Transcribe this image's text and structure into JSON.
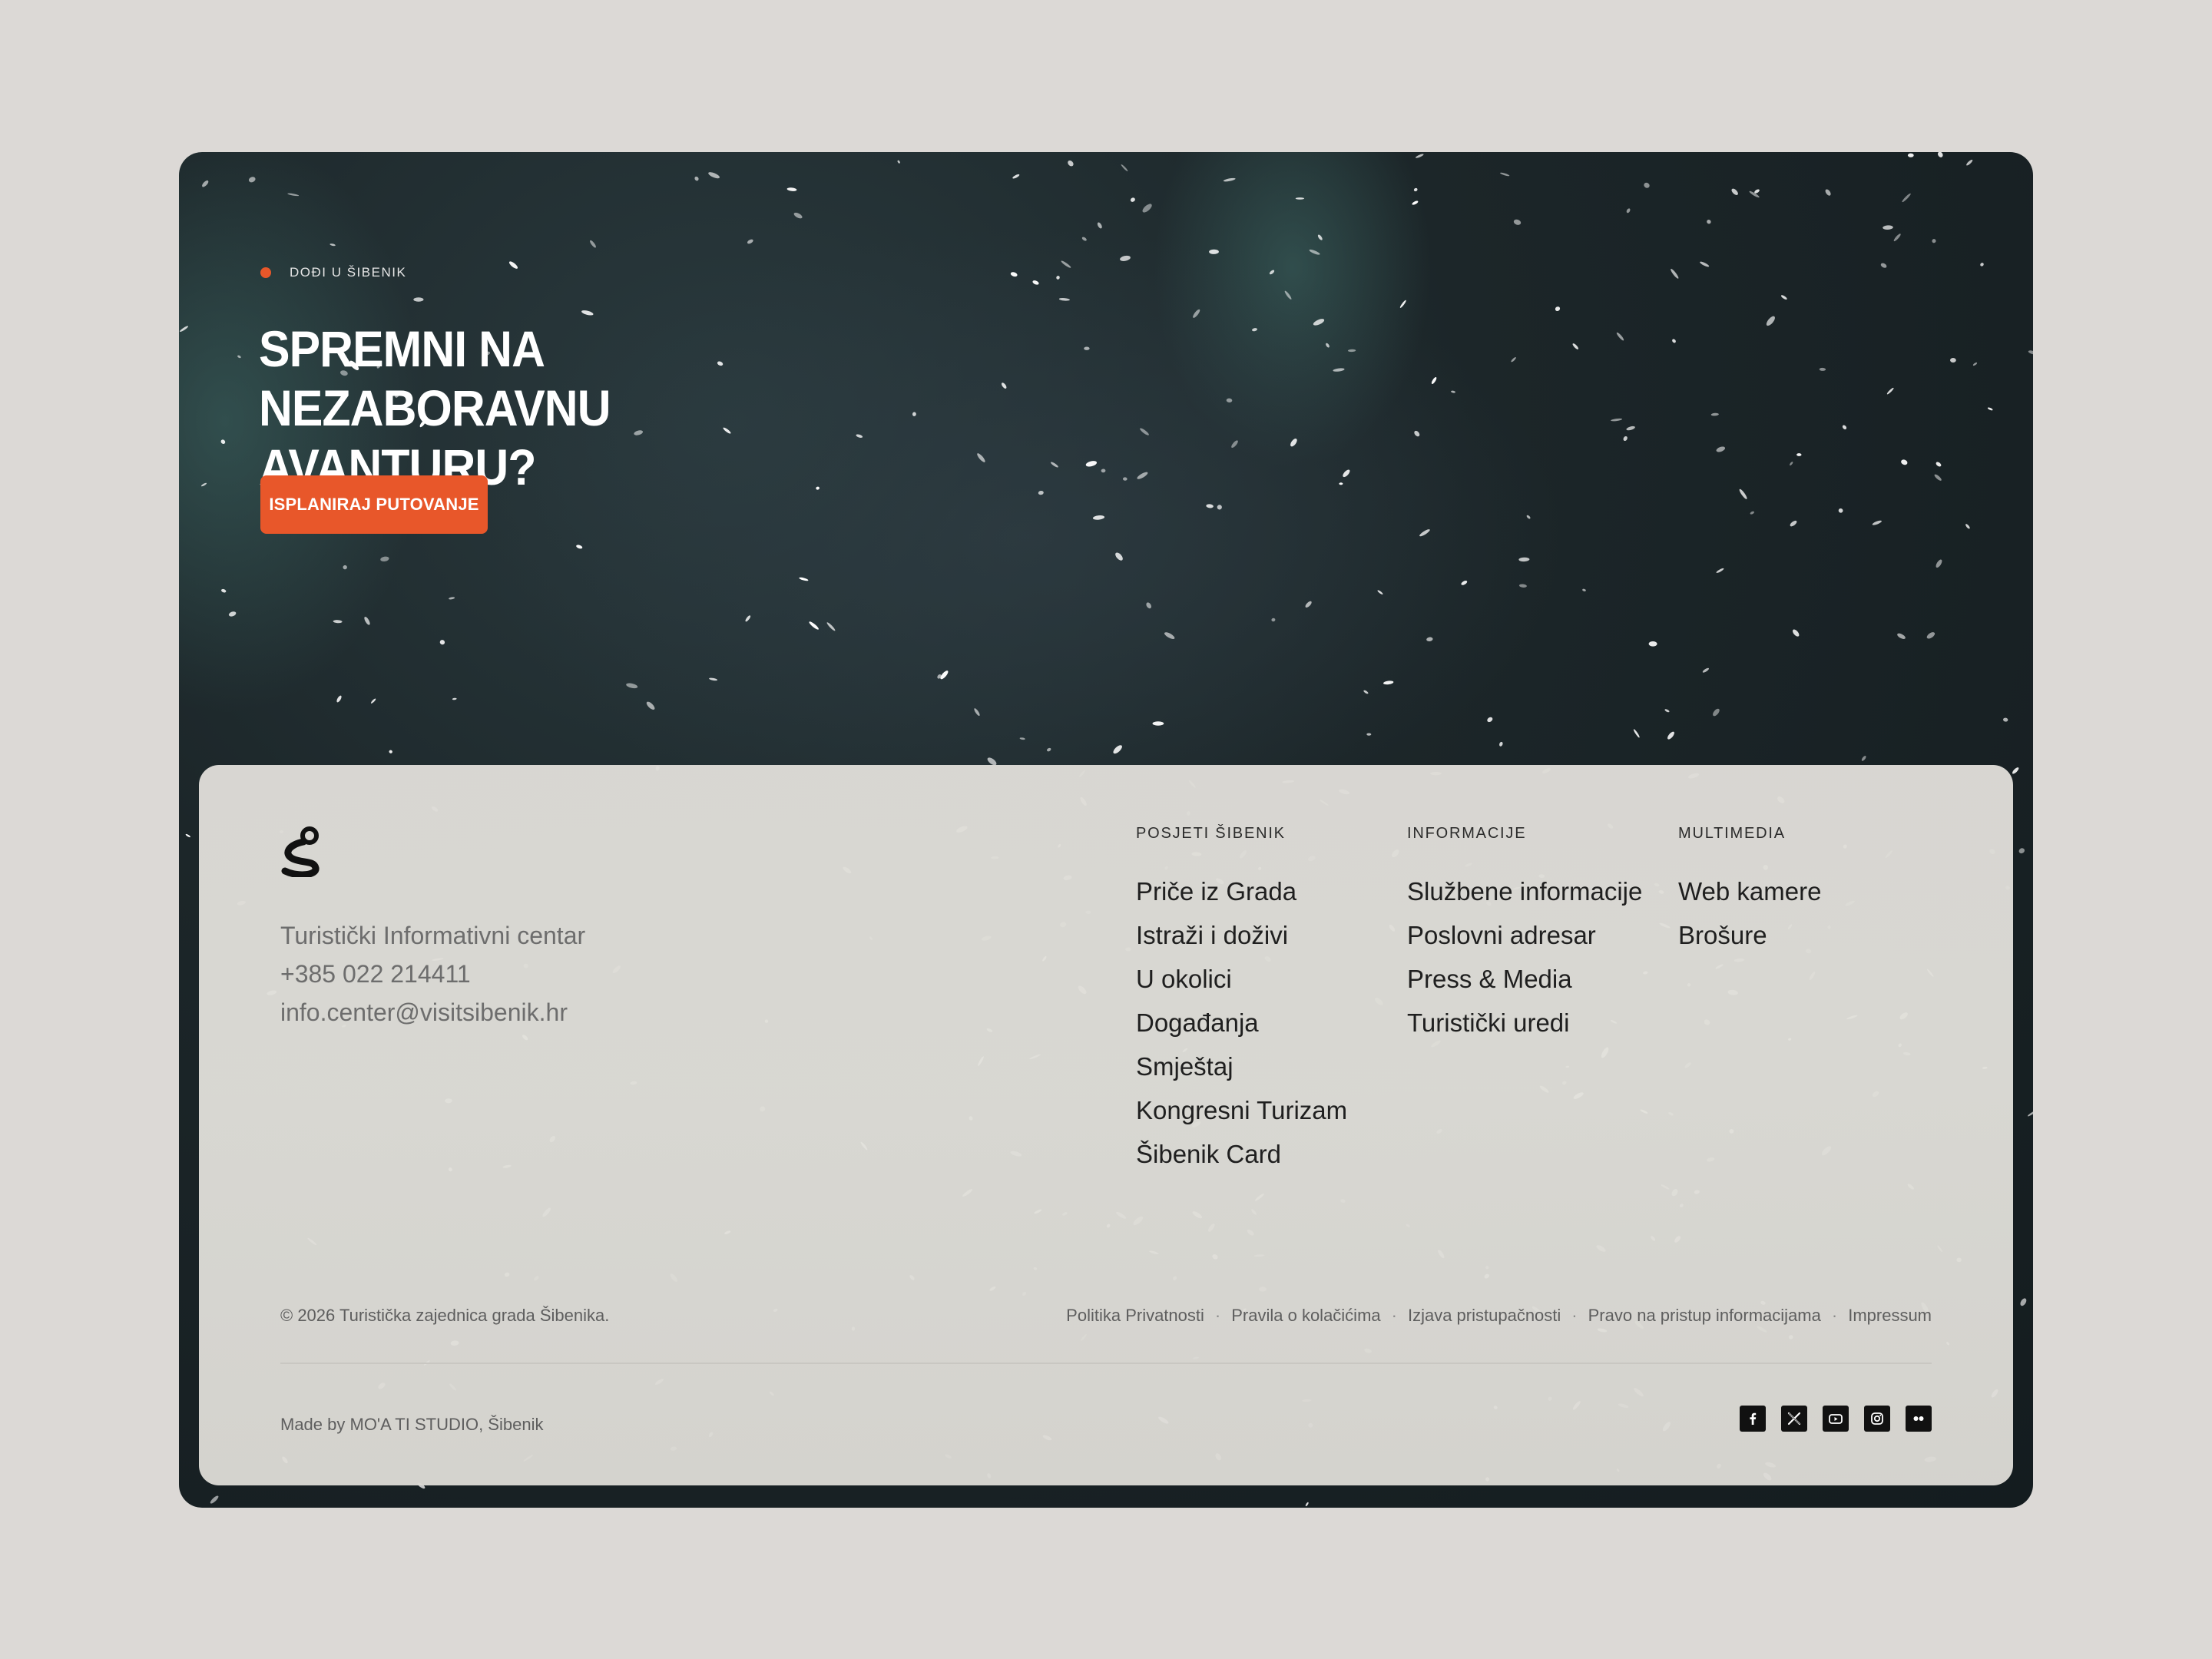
{
  "hero": {
    "eyebrow": "DOĐI U ŠIBENIK",
    "title": "SPREMNI NA NEZABORAVNU AVANTURU?",
    "cta_label": "ISPLANIRAJ PUTOVANJE"
  },
  "contact": {
    "name": "Turistički Informativni centar",
    "phone": "+385 022 214411",
    "email": "info.center@visitsibenik.hr"
  },
  "columns": [
    {
      "heading": "POSJETI ŠIBENIK",
      "items": [
        "Priče iz Grada",
        "Istraži i doživi",
        "U okolici",
        "Događanja",
        "Smještaj",
        "Kongresni Turizam",
        "Šibenik Card"
      ]
    },
    {
      "heading": "INFORMACIJE",
      "items": [
        "Službene informacije",
        "Poslovni adresar",
        "Press & Media",
        "Turistički uredi"
      ]
    },
    {
      "heading": "MULTIMEDIA",
      "items": [
        "Web kamere",
        "Brošure"
      ]
    }
  ],
  "legal": {
    "copyright": "© 2026 Turistička zajednica grada Šibenika.",
    "links": [
      "Politika Privatnosti",
      "Pravila o kolačićima",
      "Izjava pristupačnosti",
      "Pravo na pristup informacijama",
      "Impressum"
    ],
    "made_by": "Made by MO'A TI STUDIO, Šibenik"
  },
  "social": [
    "facebook-icon",
    "x-icon",
    "youtube-icon",
    "instagram-icon",
    "flickr-icon"
  ],
  "colors": {
    "accent": "#e8572a",
    "page_bg": "#dcd9d6",
    "hero_bg": "#1c2629",
    "footer_bg": "#dedcd7"
  }
}
